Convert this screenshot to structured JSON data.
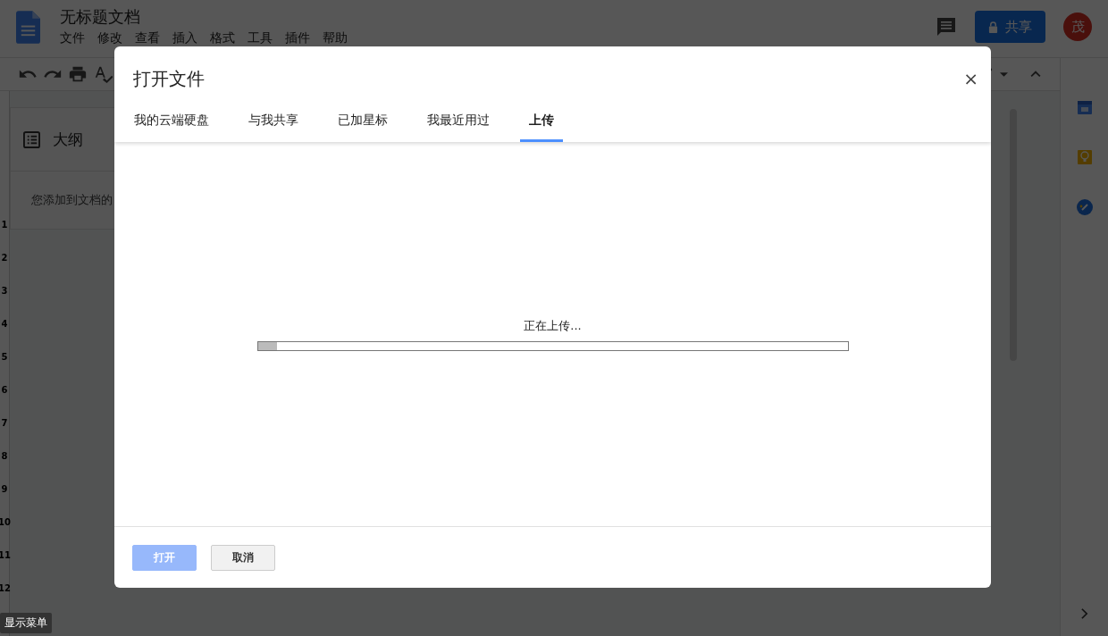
{
  "document": {
    "title": "无标题文档",
    "menu": [
      "文件",
      "修改",
      "查看",
      "插入",
      "格式",
      "工具",
      "插件",
      "帮助"
    ]
  },
  "share_button": {
    "label": "共享"
  },
  "avatar": {
    "initial": "茂"
  },
  "outline": {
    "title": "大纲",
    "hint": "您添加到文档的"
  },
  "ruler": {
    "marks": [
      "1",
      "2",
      "3",
      "4",
      "5",
      "6",
      "7",
      "8",
      "9",
      "10",
      "11",
      "12"
    ]
  },
  "dialog": {
    "title": "打开文件",
    "close": "×",
    "tabs": [
      {
        "label": "我的云端硬盘",
        "selected": false
      },
      {
        "label": "与我共享",
        "selected": false
      },
      {
        "label": "已加星标",
        "selected": false
      },
      {
        "label": "我最近用过",
        "selected": false
      },
      {
        "label": "上传",
        "selected": true
      }
    ],
    "upload": {
      "status": "正在上传...",
      "level": 0.033
    },
    "buttons": [
      {
        "label": "打开",
        "disabled": true
      },
      {
        "label": "取消",
        "disabled": false
      }
    ]
  },
  "tooltip": {
    "label": "显示菜单"
  }
}
